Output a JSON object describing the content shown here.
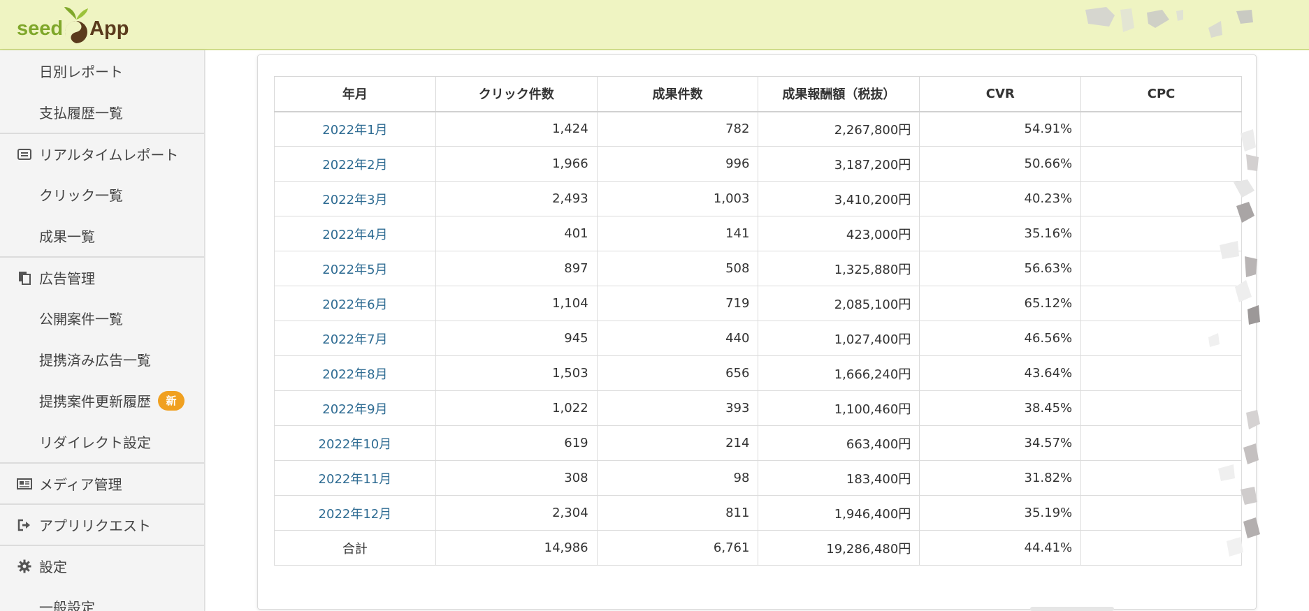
{
  "app": {
    "logo_left": "seed",
    "logo_right": "App"
  },
  "sidebar": {
    "items": [
      {
        "label": "日別レポート",
        "type": "sub"
      },
      {
        "label": "支払履歴一覧",
        "type": "sub"
      },
      {
        "label": "リアルタイムレポート",
        "type": "top",
        "icon": "list-icon"
      },
      {
        "label": "クリック一覧",
        "type": "sub"
      },
      {
        "label": "成果一覧",
        "type": "sub"
      },
      {
        "label": "広告管理",
        "type": "top",
        "icon": "documents-icon"
      },
      {
        "label": "公開案件一覧",
        "type": "sub"
      },
      {
        "label": "提携済み広告一覧",
        "type": "sub"
      },
      {
        "label": "提携案件更新履歴",
        "type": "sub",
        "badge": "新"
      },
      {
        "label": "リダイレクト設定",
        "type": "sub"
      },
      {
        "label": "メディア管理",
        "type": "top",
        "icon": "newspaper-icon"
      },
      {
        "label": "アプリリクエスト",
        "type": "top",
        "icon": "sign-out-icon"
      },
      {
        "label": "設定",
        "type": "top",
        "icon": "gear-icon"
      },
      {
        "label": "一般設定",
        "type": "sub"
      }
    ]
  },
  "table": {
    "headers": [
      "年月",
      "クリック件数",
      "成果件数",
      "成果報酬額（税抜）",
      "CVR",
      "CPC"
    ],
    "rows": [
      {
        "month": "2022年1月",
        "clicks": "1,424",
        "conversions": "782",
        "reward": "2,267,800円",
        "cvr": "54.91%",
        "cpc": ""
      },
      {
        "month": "2022年2月",
        "clicks": "1,966",
        "conversions": "996",
        "reward": "3,187,200円",
        "cvr": "50.66%",
        "cpc": ""
      },
      {
        "month": "2022年3月",
        "clicks": "2,493",
        "conversions": "1,003",
        "reward": "3,410,200円",
        "cvr": "40.23%",
        "cpc": ""
      },
      {
        "month": "2022年4月",
        "clicks": "401",
        "conversions": "141",
        "reward": "423,000円",
        "cvr": "35.16%",
        "cpc": ""
      },
      {
        "month": "2022年5月",
        "clicks": "897",
        "conversions": "508",
        "reward": "1,325,880円",
        "cvr": "56.63%",
        "cpc": ""
      },
      {
        "month": "2022年6月",
        "clicks": "1,104",
        "conversions": "719",
        "reward": "2,085,100円",
        "cvr": "65.12%",
        "cpc": ""
      },
      {
        "month": "2022年7月",
        "clicks": "945",
        "conversions": "440",
        "reward": "1,027,400円",
        "cvr": "46.56%",
        "cpc": ""
      },
      {
        "month": "2022年8月",
        "clicks": "1,503",
        "conversions": "656",
        "reward": "1,666,240円",
        "cvr": "43.64%",
        "cpc": ""
      },
      {
        "month": "2022年9月",
        "clicks": "1,022",
        "conversions": "393",
        "reward": "1,100,460円",
        "cvr": "38.45%",
        "cpc": ""
      },
      {
        "month": "2022年10月",
        "clicks": "619",
        "conversions": "214",
        "reward": "663,400円",
        "cvr": "34.57%",
        "cpc": ""
      },
      {
        "month": "2022年11月",
        "clicks": "308",
        "conversions": "98",
        "reward": "183,400円",
        "cvr": "31.82%",
        "cpc": ""
      },
      {
        "month": "2022年12月",
        "clicks": "2,304",
        "conversions": "811",
        "reward": "1,946,400円",
        "cvr": "35.19%",
        "cpc": ""
      }
    ],
    "total": {
      "label": "合計",
      "clicks": "14,986",
      "conversions": "6,761",
      "reward": "19,286,480円",
      "cvr": "44.41%",
      "cpc": ""
    }
  },
  "colors": {
    "header_bg": "#eff4c2",
    "link": "#2f6c93",
    "badge": "#f0a020",
    "logo_green": "#7fa72a",
    "logo_brown": "#5a3a1c"
  }
}
